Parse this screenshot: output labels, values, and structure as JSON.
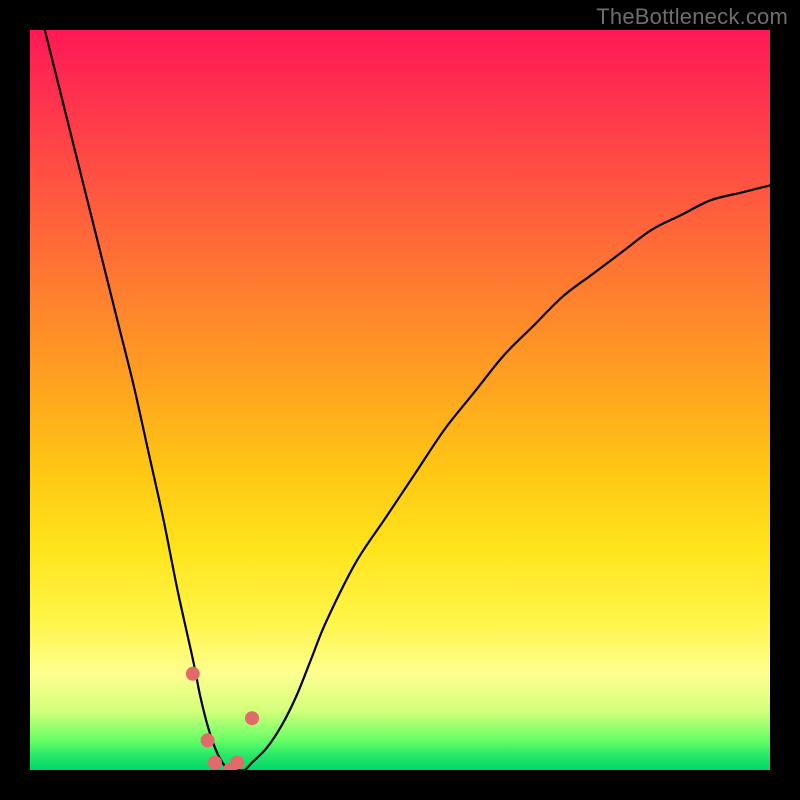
{
  "watermark": "TheBottleneck.com",
  "chart_data": {
    "type": "line",
    "title": "",
    "xlabel": "",
    "ylabel": "",
    "xlim": [
      0,
      100
    ],
    "ylim": [
      0,
      100
    ],
    "grid": false,
    "legend": false,
    "x": [
      0,
      2,
      4,
      6,
      8,
      10,
      12,
      14,
      16,
      18,
      20,
      22,
      23,
      24,
      25,
      26,
      27,
      28,
      29,
      30,
      32,
      34,
      36,
      38,
      40,
      44,
      48,
      52,
      56,
      60,
      64,
      68,
      72,
      76,
      80,
      84,
      88,
      92,
      96,
      100
    ],
    "values": [
      108,
      100,
      92,
      84,
      76,
      68,
      60,
      52,
      43,
      34,
      24,
      15,
      10,
      6,
      3,
      1,
      0,
      0,
      0,
      1,
      3,
      6,
      10,
      15,
      20,
      28,
      34,
      40,
      46,
      51,
      56,
      60,
      64,
      67,
      70,
      73,
      75,
      77,
      78,
      79
    ],
    "markers": {
      "x": [
        22,
        24,
        25,
        27,
        28,
        30
      ],
      "y": [
        13,
        4,
        1,
        0,
        1,
        7
      ]
    },
    "colors": {
      "line": "#000000",
      "marker": "#e26a6a",
      "gradient_top": "#ff1955",
      "gradient_mid": "#ffe41c",
      "gradient_bottom": "#00d868"
    }
  }
}
